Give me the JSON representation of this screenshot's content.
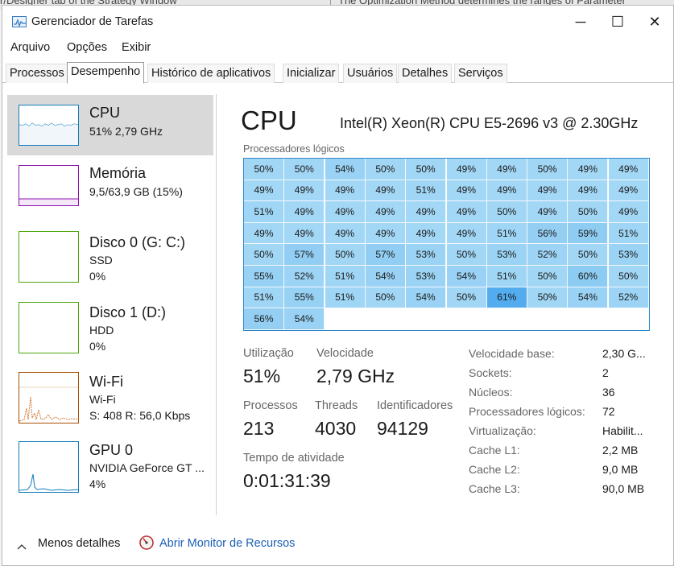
{
  "background": {
    "left_text": "r/Designer tab of the Strategy Window",
    "right_text": "The Optimization Method determines the ranges of Parameter"
  },
  "window": {
    "title": "Gerenciador de Tarefas",
    "minimize": "─",
    "maximize": "☐",
    "close": "✕"
  },
  "menu": [
    "Arquivo",
    "Opções",
    "Exibir"
  ],
  "tabs": [
    "Processos",
    "Desempenho",
    "Histórico de aplicativos",
    "Inicializar",
    "Usuários",
    "Detalhes",
    "Serviços"
  ],
  "active_tab": "Desempenho",
  "sidebar": {
    "items": [
      {
        "title": "CPU",
        "line1": "51%  2,79 GHz",
        "line2": "",
        "color": "#117dbb"
      },
      {
        "title": "Memória",
        "line1": "9,5/63,9 GB (15%)",
        "line2": "",
        "color": "#8b12ae"
      },
      {
        "title": "Disco 0 (G: C:)",
        "line1": "SSD",
        "line2": "0%",
        "color": "#4da60c"
      },
      {
        "title": "Disco 1 (D:)",
        "line1": "HDD",
        "line2": "0%",
        "color": "#4da60c"
      },
      {
        "title": "Wi-Fi",
        "line1": "Wi-Fi",
        "line2": "S: 408  R: 56,0 Kbps",
        "color": "#a74f01"
      },
      {
        "title": "GPU 0",
        "line1": "NVIDIA GeForce GT ...",
        "line2": "4%",
        "color": "#117dbb"
      }
    ]
  },
  "main": {
    "title": "CPU",
    "cpu_name": "Intel(R) Xeon(R) CPU E5-2696 v3 @ 2.30GHz",
    "grid_label": "Processadores lógicos",
    "cores": [
      "50%",
      "50%",
      "54%",
      "50%",
      "50%",
      "49%",
      "49%",
      "50%",
      "49%",
      "49%",
      "49%",
      "49%",
      "49%",
      "49%",
      "51%",
      "49%",
      "49%",
      "49%",
      "49%",
      "49%",
      "51%",
      "49%",
      "49%",
      "49%",
      "49%",
      "49%",
      "50%",
      "49%",
      "50%",
      "49%",
      "49%",
      "49%",
      "49%",
      "49%",
      "49%",
      "49%",
      "51%",
      "56%",
      "59%",
      "51%",
      "50%",
      "57%",
      "50%",
      "57%",
      "53%",
      "50%",
      "53%",
      "52%",
      "50%",
      "53%",
      "55%",
      "52%",
      "51%",
      "54%",
      "53%",
      "54%",
      "51%",
      "50%",
      "60%",
      "50%",
      "51%",
      "55%",
      "51%",
      "50%",
      "54%",
      "50%",
      "61%",
      "50%",
      "54%",
      "52%",
      "56%",
      "54%"
    ],
    "stats": {
      "utilizacao_label": "Utilização",
      "utilizacao": "51%",
      "velocidade_label": "Velocidade",
      "velocidade": "2,79 GHz",
      "processos_label": "Processos",
      "processos": "213",
      "threads_label": "Threads",
      "threads": "4030",
      "ids_label": "Identificadores",
      "ids": "94129",
      "tempo_label": "Tempo de atividade",
      "tempo": "0:01:31:39"
    },
    "details": [
      {
        "k": "Velocidade base:",
        "v": "2,30 G..."
      },
      {
        "k": "Sockets:",
        "v": "2"
      },
      {
        "k": "Núcleos:",
        "v": "36"
      },
      {
        "k": "Processadores lógicos:",
        "v": "72"
      },
      {
        "k": "Virtualização:",
        "v": "Habilit..."
      },
      {
        "k": "Cache L1:",
        "v": "2,2 MB"
      },
      {
        "k": "Cache L2:",
        "v": "9,0 MB"
      },
      {
        "k": "Cache L3:",
        "v": "90,0 MB"
      }
    ]
  },
  "footer": {
    "less_details": "Menos detalhes",
    "open_monitor": "Abrir Monitor de Recursos"
  }
}
